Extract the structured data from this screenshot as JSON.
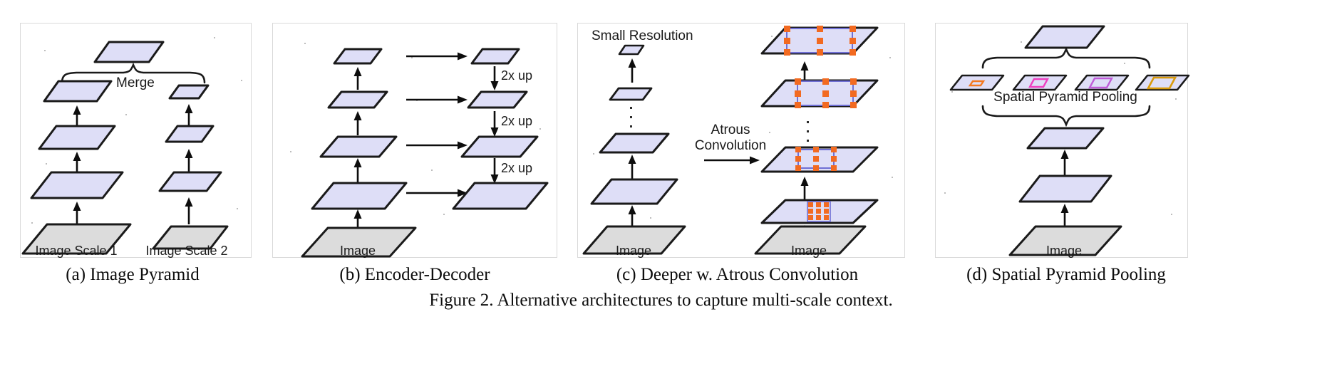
{
  "figure": {
    "caption": "Figure 2. Alternative architectures to capture multi-scale context."
  },
  "colors": {
    "slab_feature_fill": "#dedef7",
    "slab_image_fill": "#dcdcdc",
    "slab_stroke": "#1a1a1a",
    "kernel_border": "#6f6fd4",
    "kernel_dot": "#f26a21",
    "spp_box_1": "#f47920",
    "spp_box_2": "#ef3ec0",
    "spp_box_3": "#c05bd8",
    "spp_box_4": "#d99a0b",
    "panel_border": "#d9d9d9"
  },
  "panels": [
    {
      "id": "a",
      "caption": "(a) Image Pyramid",
      "labels": {
        "merge": "Merge",
        "image_scale_1": "Image Scale 1",
        "image_scale_2": "Image Scale 2"
      }
    },
    {
      "id": "b",
      "caption": "(b) Encoder-Decoder",
      "labels": {
        "image": "Image",
        "upsample_1": "2x up",
        "upsample_2": "2x up",
        "upsample_3": "2x up"
      }
    },
    {
      "id": "c",
      "caption": "(c) Deeper w. Atrous Convolution",
      "labels": {
        "small_resolution": "Small Resolution",
        "atrous_line1": "Atrous",
        "atrous_line2": "Convolution",
        "image_left": "Image",
        "image_right": "Image"
      }
    },
    {
      "id": "d",
      "caption": "(d) Spatial Pyramid Pooling",
      "labels": {
        "spatial_pyramid_pooling": "Spatial Pyramid Pooling",
        "image": "Image"
      }
    }
  ]
}
